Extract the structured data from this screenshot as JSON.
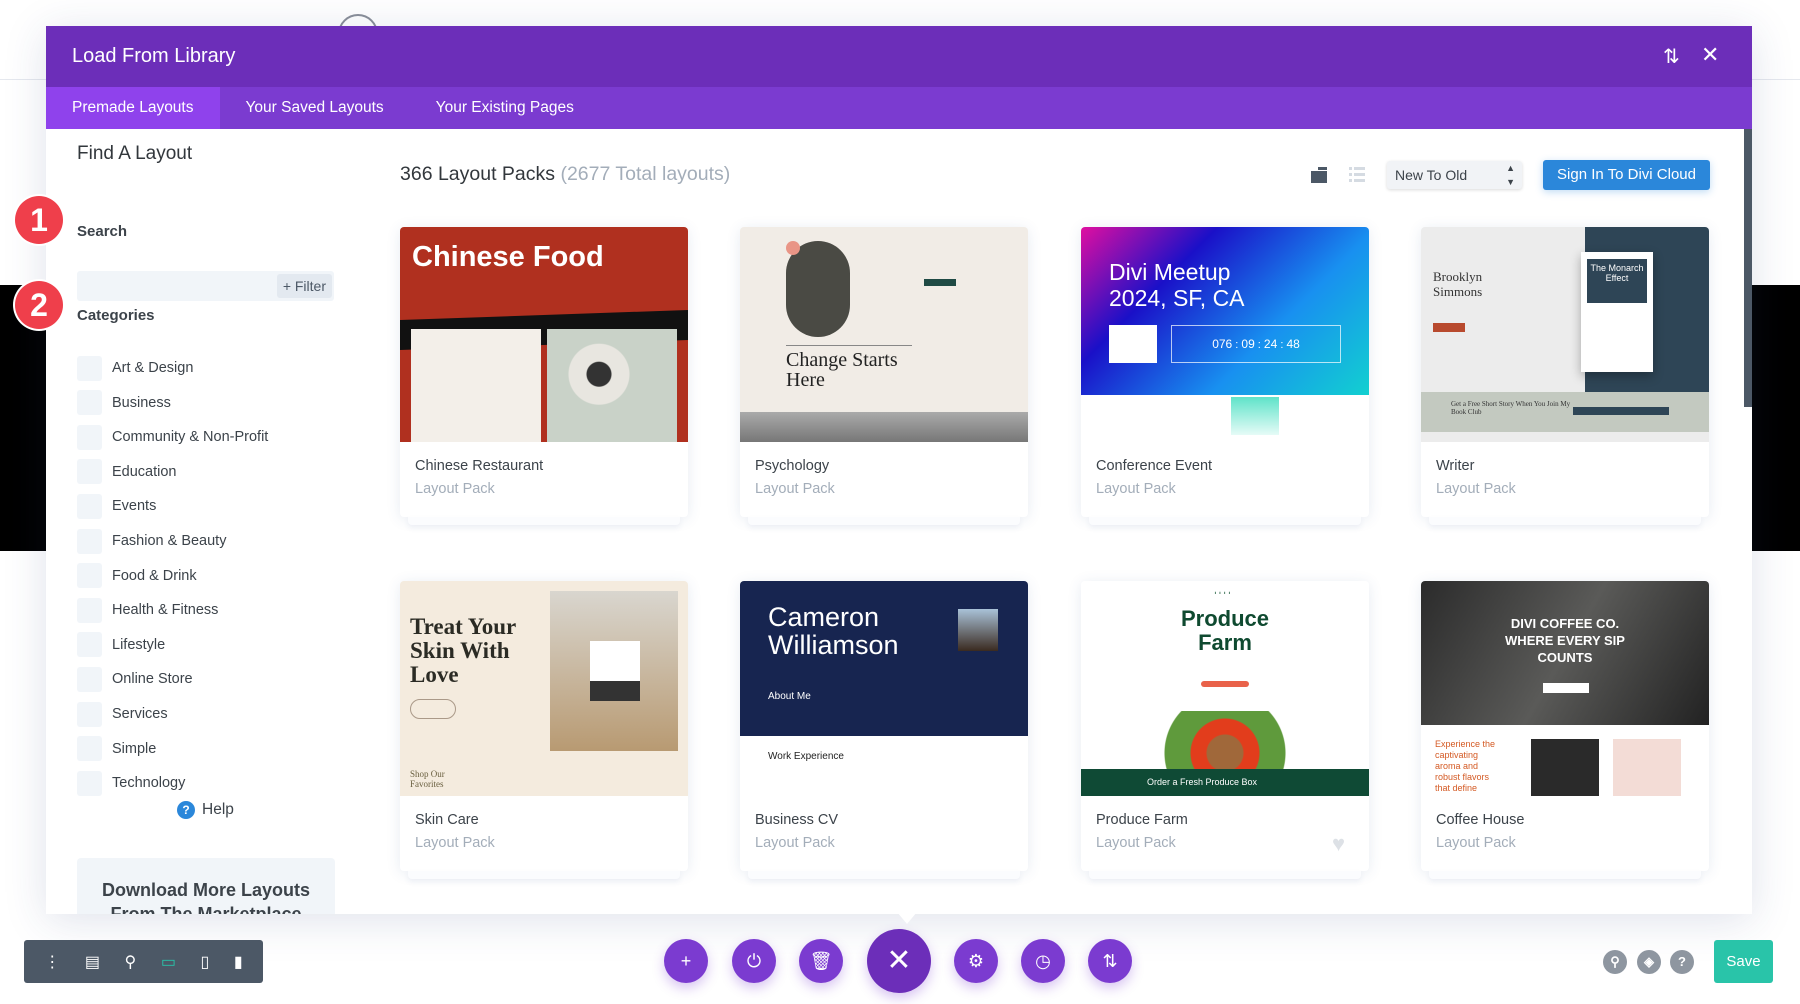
{
  "dialog": {
    "title": "Load From Library",
    "tabs": [
      {
        "label": "Premade Layouts",
        "active": true
      },
      {
        "label": "Your Saved Layouts",
        "active": false
      },
      {
        "label": "Your Existing Pages",
        "active": false
      }
    ],
    "sort_icon": "sort-arrows-icon",
    "close_icon": "close-icon"
  },
  "sidebar": {
    "heading": "Find A Layout",
    "search_label": "Search",
    "search_value": "",
    "filter_label": "+ Filter",
    "categories_label": "Categories",
    "categories": [
      "Art & Design",
      "Business",
      "Community & Non-Profit",
      "Education",
      "Events",
      "Fashion & Beauty",
      "Food & Drink",
      "Health & Fitness",
      "Lifestyle",
      "Online Store",
      "Services",
      "Simple",
      "Technology"
    ],
    "help_label": "Help",
    "download_label": "Download More Layouts From The Marketplace"
  },
  "badges": [
    "1",
    "2"
  ],
  "main": {
    "count_label": "366 Layout Packs",
    "total_label": "(2677 Total layouts)",
    "sort_value": "New To Old",
    "cloud_button": "Sign In To Divi Cloud",
    "cards": [
      {
        "name": "Chinese Restaurant",
        "type": "Layout Pack",
        "thumb_title": "Chinese Food"
      },
      {
        "name": "Psychology",
        "type": "Layout Pack",
        "thumb_title": "Change Starts Here"
      },
      {
        "name": "Conference Event",
        "type": "Layout Pack",
        "thumb_title": "Divi Meetup 2024, SF, CA",
        "countdown": [
          "076",
          "09",
          "24",
          "48"
        ]
      },
      {
        "name": "Writer",
        "type": "Layout Pack",
        "thumb_title": "Brooklyn Simmons",
        "book_title": "The Monarch Effect",
        "club": "Get a Free Short Story When You Join My Book Club"
      },
      {
        "name": "Skin Care",
        "type": "Layout Pack",
        "thumb_title": "Treat Your Skin With Love",
        "sub": "Shop Our Favorites"
      },
      {
        "name": "Business CV",
        "type": "Layout Pack",
        "thumb_title": "Cameron Williamson",
        "about": "About Me",
        "work": "Work Experience"
      },
      {
        "name": "Produce Farm",
        "type": "Layout Pack",
        "thumb_title": "Produce Farm",
        "banner": "Order a Fresh Produce Box"
      },
      {
        "name": "Coffee House",
        "type": "Layout Pack",
        "thumb_title": "DIVI COFFEE CO. WHERE EVERY SIP COUNTS",
        "blurb": "Experience the captivating aroma and robust flavors that define Coffee Haven, where each"
      }
    ]
  },
  "toolbar": {
    "save_label": "Save",
    "colors": {
      "purple": "#7b3bd0",
      "save": "#29c4a9",
      "blue": "#2b87da"
    }
  }
}
